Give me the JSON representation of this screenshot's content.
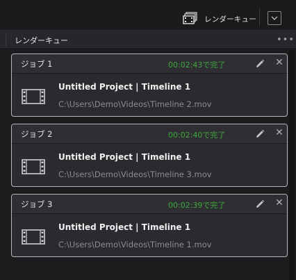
{
  "topbar": {
    "render_queue_label": "レンダーキュー",
    "render_queue_icon": "render-queue-icon",
    "toggle_icon": "chevron-down-icon"
  },
  "panel": {
    "title": "レンダーキュー",
    "more_icon": "more-options-icon"
  },
  "jobs": [
    {
      "name": "ジョブ 1",
      "status": "00:02:43で完了",
      "project": "Untitled Project | Timeline 1",
      "path": "C:\\Users\\Demo\\Videos\\Timeline 2.mov"
    },
    {
      "name": "ジョブ 2",
      "status": "00:02:40で完了",
      "project": "Untitled Project | Timeline 1",
      "path": "C:\\Users\\Demo\\Videos\\Timeline 3.mov"
    },
    {
      "name": "ジョブ 3",
      "status": "00:02:39で完了",
      "project": "Untitled Project | Timeline 1",
      "path": "C:\\Users\\Demo\\Videos\\Timeline 1.mov"
    }
  ],
  "colors": {
    "status_complete": "#3ea83e",
    "card_border": "#b8b8bc"
  }
}
